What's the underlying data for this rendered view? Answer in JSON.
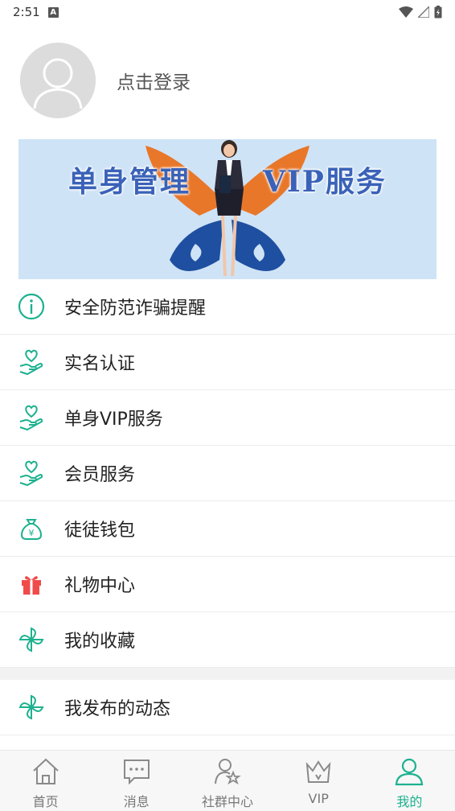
{
  "status_bar": {
    "time": "2:51",
    "badge": "A"
  },
  "profile": {
    "login_text": "点击登录"
  },
  "banner": {
    "left_text": "单身管理",
    "right_text": "VIP服务"
  },
  "menu": {
    "items": [
      {
        "label": "安全防范诈骗提醒",
        "icon": "info-icon"
      },
      {
        "label": "实名认证",
        "icon": "heart-hand-icon"
      },
      {
        "label": "单身VIP服务",
        "icon": "heart-hand-icon"
      },
      {
        "label": "会员服务",
        "icon": "heart-hand-icon"
      },
      {
        "label": "徒徒钱包",
        "icon": "money-bag-icon"
      },
      {
        "label": "礼物中心",
        "icon": "gift-icon"
      },
      {
        "label": "我的收藏",
        "icon": "pinwheel-icon"
      }
    ],
    "items2": [
      {
        "label": "我发布的动态",
        "icon": "pinwheel-icon"
      }
    ]
  },
  "tabbar": {
    "tabs": [
      {
        "label": "首页",
        "icon": "home-icon"
      },
      {
        "label": "消息",
        "icon": "message-icon"
      },
      {
        "label": "社群中心",
        "icon": "community-icon"
      },
      {
        "label": "VIP",
        "icon": "crown-icon"
      },
      {
        "label": "我的",
        "icon": "user-icon",
        "active": true
      }
    ]
  },
  "colors": {
    "accent": "#1db18f",
    "gift": "#f04b4b",
    "banner_bg": "#cfe3f6"
  }
}
